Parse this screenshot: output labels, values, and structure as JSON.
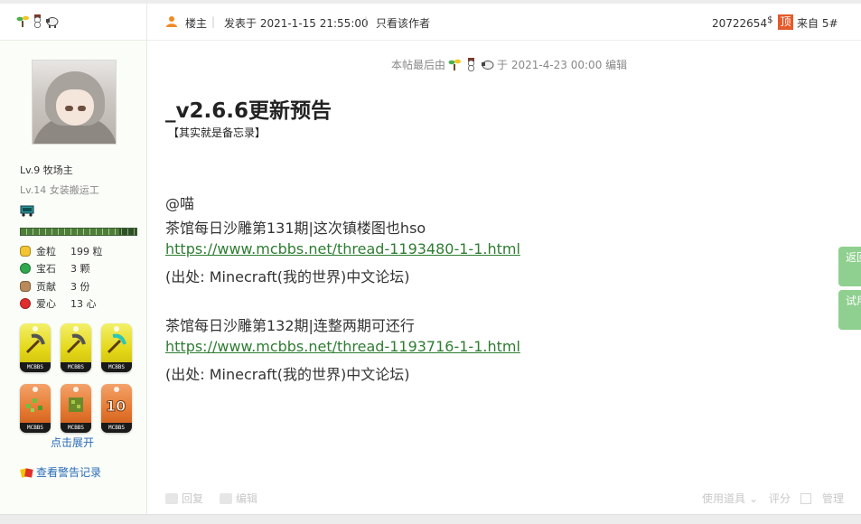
{
  "user": {
    "level": "Lv.9 牧场主",
    "sub_level": "Lv.14 女装搬运工",
    "progress": 0.85,
    "stats": [
      {
        "label": "金粒",
        "value": "199 粒",
        "icon": "gold-nugget-icon",
        "color": "#f2c531"
      },
      {
        "label": "宝石",
        "value": "3 颗",
        "icon": "emerald-icon",
        "color": "#2fa84f"
      },
      {
        "label": "贡献",
        "value": "3 份",
        "icon": "cookie-icon",
        "color": "#b98a5a"
      },
      {
        "label": "爱心",
        "value": "13 心",
        "icon": "apple-icon",
        "color": "#e02d2d"
      }
    ],
    "badges": [
      {
        "color": "yellow",
        "icon": "pickaxe-icon",
        "tag": "MCBBS"
      },
      {
        "color": "yellow",
        "icon": "pickaxe-icon",
        "tag": "MCBBS"
      },
      {
        "color": "yellow",
        "icon": "diamond-pickaxe-icon",
        "tag": "MCBBS"
      },
      {
        "color": "orange",
        "icon": "grass-icon",
        "tag": "MCBBS"
      },
      {
        "color": "orange",
        "icon": "bush-icon",
        "tag": "MCBBS"
      },
      {
        "color": "orange",
        "icon": "ten-icon",
        "tag": "MCBBS"
      }
    ],
    "expand_label": "点击展开",
    "warn_label": "查看警告记录"
  },
  "post": {
    "op_label": "楼主",
    "posted_at": "发表于 2021-1-15 21:55:00",
    "only_author": "只看该作者",
    "uid": "20722654",
    "uid_suffix": "$",
    "top_label": "顶",
    "floor": "来自 5#",
    "edited_prefix": "本帖最后由",
    "edited_suffix": "于 2021-4-23 00:00 编辑",
    "title": "_v2.6.6更新预告",
    "subtitle": "【其实就是备忘录】",
    "lines": [
      {
        "text": "@喵",
        "link": false
      },
      {
        "text": "茶馆每日沙雕第131期|这次镇楼图也hso",
        "link": false
      },
      {
        "text": "https://www.mcbbs.net/thread-1193480-1-1.html",
        "link": true
      },
      {
        "text": "(出处: Minecraft(我的世界)中文论坛)",
        "link": false
      },
      {
        "text": "茶馆每日沙雕第132期|连整两期可还行",
        "link": false
      },
      {
        "text": "https://www.mcbbs.net/thread-1193716-1-1.html",
        "link": true
      },
      {
        "text": "(出处: Minecraft(我的世界)中文论坛)",
        "link": false
      }
    ],
    "actions": {
      "reply": "回复",
      "edit": "编辑",
      "use_item": "使用道具",
      "rate": "评分",
      "manage": "管理"
    }
  },
  "floating": {
    "back_old": "返回旧版",
    "feedback": "试用反馈"
  }
}
